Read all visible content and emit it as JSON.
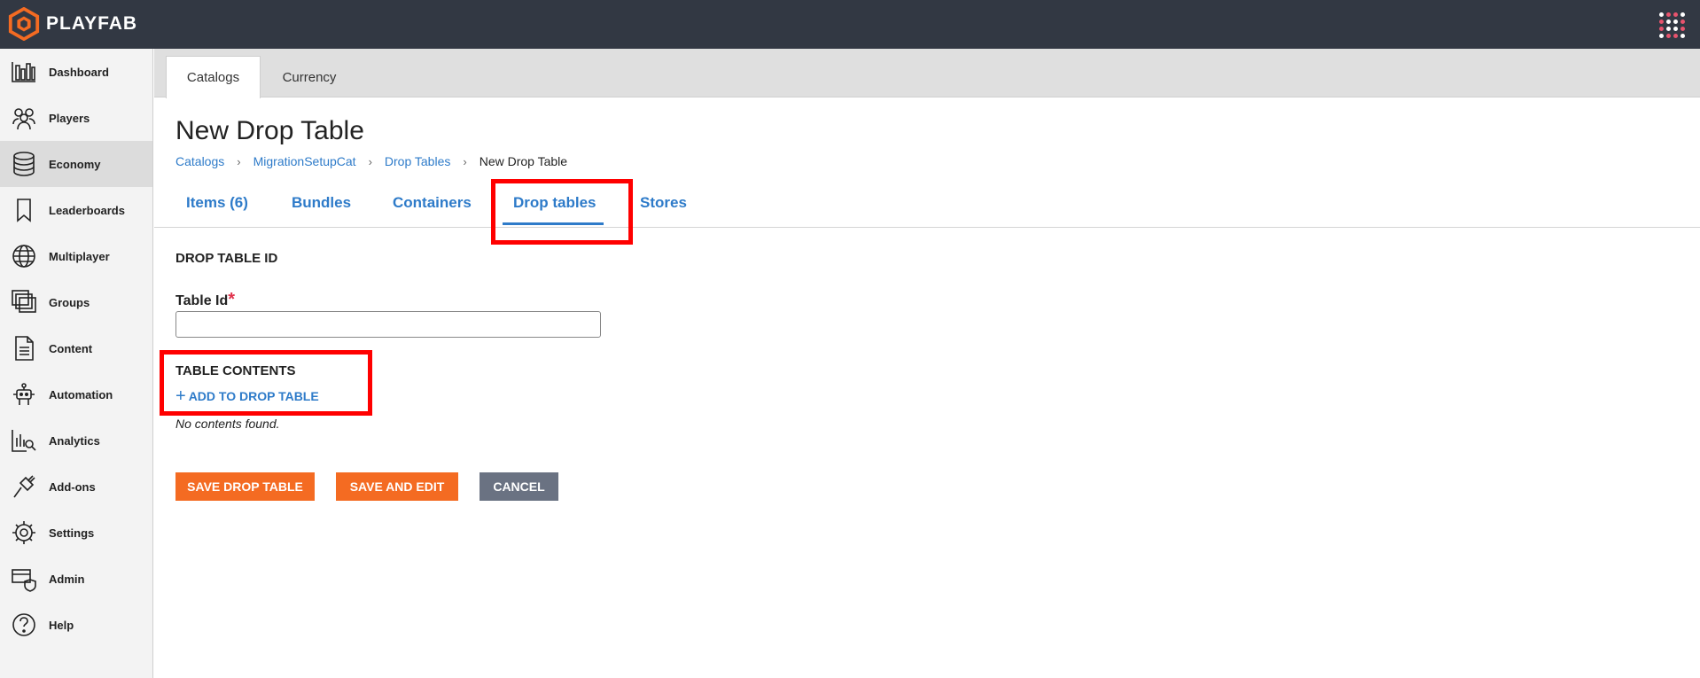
{
  "app": {
    "brand": "PLAYFAB",
    "accent_color": "#f46b22",
    "link_color": "#2e7bc9",
    "highlight_color": "#ff0000"
  },
  "sidebar": {
    "items": [
      {
        "label": "Dashboard",
        "icon": "bar-chart-icon"
      },
      {
        "label": "Players",
        "icon": "players-icon"
      },
      {
        "label": "Economy",
        "icon": "database-icon",
        "active": true
      },
      {
        "label": "Leaderboards",
        "icon": "bookmark-icon"
      },
      {
        "label": "Multiplayer",
        "icon": "globe-icon"
      },
      {
        "label": "Groups",
        "icon": "groups-icon"
      },
      {
        "label": "Content",
        "icon": "document-icon"
      },
      {
        "label": "Automation",
        "icon": "robot-icon"
      },
      {
        "label": "Analytics",
        "icon": "analytics-icon"
      },
      {
        "label": "Add-ons",
        "icon": "plug-icon"
      },
      {
        "label": "Settings",
        "icon": "gear-icon"
      },
      {
        "label": "Admin",
        "icon": "admin-shield-icon"
      },
      {
        "label": "Help",
        "icon": "help-icon"
      }
    ]
  },
  "subtabs": [
    {
      "label": "Catalogs",
      "active": true
    },
    {
      "label": "Currency",
      "active": false
    }
  ],
  "page": {
    "title": "New Drop Table",
    "breadcrumb": [
      "Catalogs",
      "MigrationSetupCat",
      "Drop Tables",
      "New Drop Table"
    ]
  },
  "tabs": [
    {
      "label": "Items (6)"
    },
    {
      "label": "Bundles"
    },
    {
      "label": "Containers"
    },
    {
      "label": "Drop tables",
      "active": true
    },
    {
      "label": "Stores"
    }
  ],
  "form": {
    "section_id_title": "DROP TABLE ID",
    "table_id_label": "Table Id",
    "required_marker": "*",
    "table_id_value": "",
    "contents_title": "TABLE CONTENTS",
    "add_link": "ADD TO DROP TABLE",
    "empty_note": "No contents found."
  },
  "buttons": {
    "save": "SAVE DROP TABLE",
    "save_edit": "SAVE AND EDIT",
    "cancel": "CANCEL"
  }
}
